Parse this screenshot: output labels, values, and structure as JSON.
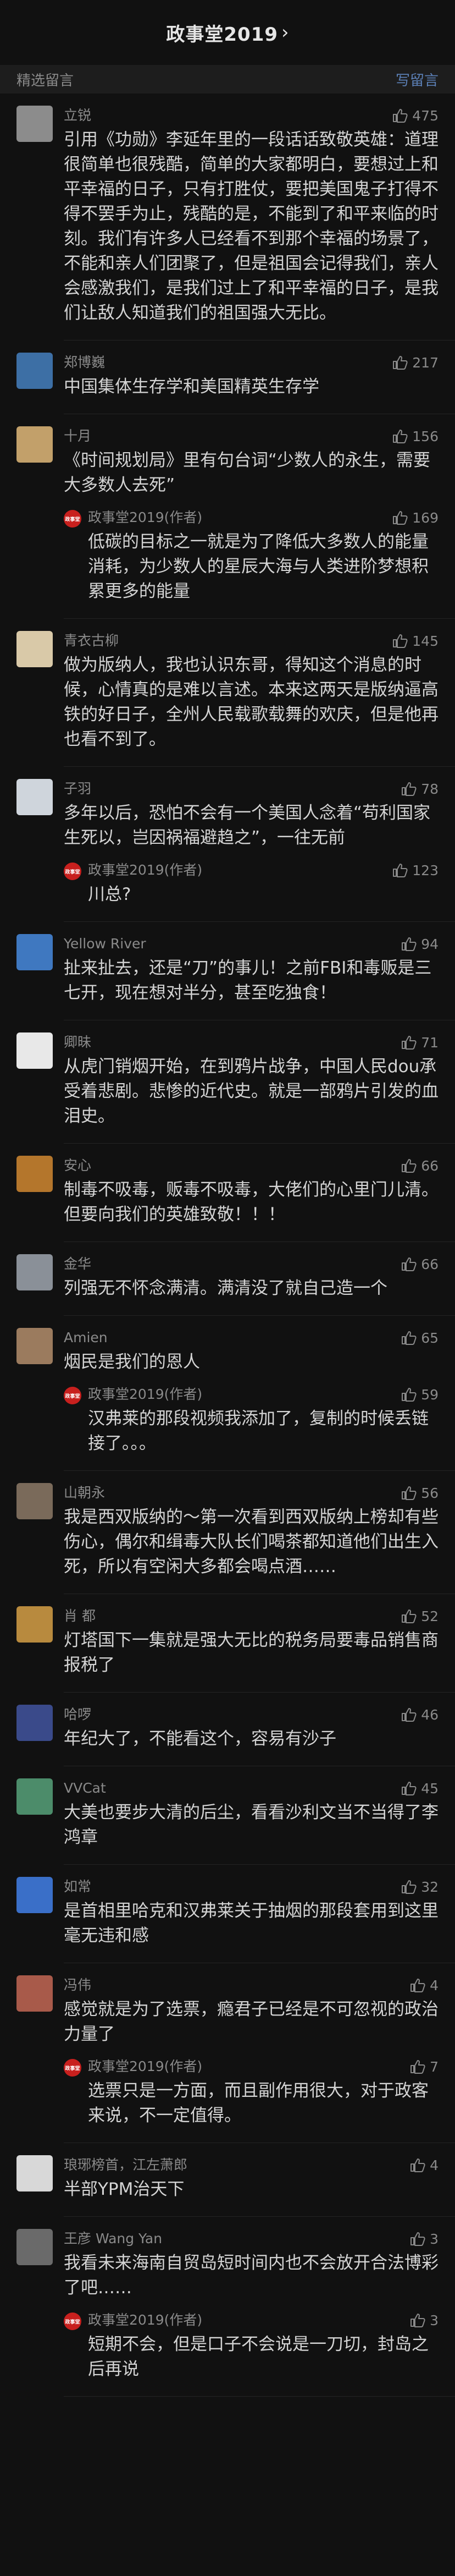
{
  "header": {
    "title": "政事堂2019",
    "chevron": "›"
  },
  "section": {
    "label": "精选留言",
    "action": "写留言"
  },
  "comments": [
    {
      "name": "立锐",
      "likes": "475",
      "avatar_color": "#8c8c8c",
      "text": "引用《功勋》李延年里的一段话话致敬英雄：道理很简单也很残酷，简单的大家都明白，要想过上和平幸福的日子，只有打胜仗，要把美国鬼子打得不得不罢手为止，残酷的是，不能到了和平来临的时刻。我们有许多人已经看不到那个幸福的场景了，不能和亲人们团聚了，但是祖国会记得我们，亲人会感激我们，是我们过上了和平幸福的日子，是我们让敌人知道我们的祖国强大无比。"
    },
    {
      "name": "郑博巍",
      "likes": "217",
      "avatar_color": "#3d6fa5",
      "text": "中国集体生存学和美国精英生存学"
    },
    {
      "name": "十月",
      "likes": "156",
      "avatar_color": "#c2a06a",
      "text": "《时间规划局》里有句台词“少数人的永生，需要大多数人去死”",
      "reply": {
        "name": "政事堂2019(作者)",
        "likes": "169",
        "text": "低碳的目标之一就是为了降低大多数人的能量消耗，为少数人的星辰大海与人类进阶梦想积累更多的能量"
      }
    },
    {
      "name": "青衣古柳",
      "likes": "145",
      "avatar_color": "#d9c9a8",
      "text": "做为版纳人，我也认识东哥，得知这个消息的时候，心情真的是难以言述。本来这两天是版纳逼高铁的好日子，全州人民载歌载舞的欢庆，但是他再也看不到了。"
    },
    {
      "name": "子羽",
      "likes": "78",
      "avatar_color": "#cfd5dc",
      "text": "多年以后，恐怕不会有一个美国人念着“苟利国家生死以，岂因祸福避趋之”，一往无前",
      "reply": {
        "name": "政事堂2019(作者)",
        "likes": "123",
        "text": "川总?"
      }
    },
    {
      "name": "Yellow River",
      "likes": "94",
      "avatar_color": "#3f78c0",
      "text": "扯来扯去，还是“刀”的事儿！之前FBI和毒贩是三七开，现在想对半分，甚至吃独食！"
    },
    {
      "name": "卿昧",
      "likes": "71",
      "avatar_color": "#e8e8e8",
      "text": "从虎门销烟开始，在到鸦片战争，中国人民dou承受着悲剧。悲惨的近代史。就是一部鸦片引发的血泪史。"
    },
    {
      "name": "安心",
      "likes": "66",
      "avatar_color": "#b4762c",
      "text": "制毒不吸毒，贩毒不吸毒，大佬们的心里门儿清。\n但要向我们的英雄致敬！！！"
    },
    {
      "name": "金华",
      "likes": "66",
      "avatar_color": "#8a9098",
      "text": "列强无不怀念满清。满清没了就自己造一个"
    },
    {
      "name": "Amien",
      "likes": "65",
      "avatar_color": "#9b7b5e",
      "text": "烟民是我们的恩人",
      "reply": {
        "name": "政事堂2019(作者)",
        "likes": "59",
        "text": "汉弗莱的那段视频我添加了，复制的时候丢链接了。。。"
      }
    },
    {
      "name": "山朝永",
      "likes": "56",
      "avatar_color": "#7a6a5a",
      "text": "我是西双版纳的～第一次看到西双版纳上榜却有些伤心，偶尔和缉毒大队长们喝茶都知道他们出生入死，所以有空闲大多都会喝点酒……"
    },
    {
      "name": "肖 都",
      "likes": "52",
      "avatar_color": "#b88a3e",
      "text": "灯塔国下一集就是强大无比的税务局要毒品销售商报税了"
    },
    {
      "name": "哈啰",
      "likes": "46",
      "avatar_color": "#3a4a8a",
      "text": "年纪大了，不能看这个，容易有沙子"
    },
    {
      "name": "VVCat",
      "likes": "45",
      "avatar_color": "#4c8c6a",
      "text": "大美也要步大清的后尘，看看沙利文当不当得了李鸿章"
    },
    {
      "name": "如常",
      "likes": "32",
      "avatar_color": "#3a6fc8",
      "text": "是首相里哈克和汉弗莱关于抽烟的那段套用到这里毫无违和感"
    },
    {
      "name": "冯伟",
      "likes": "4",
      "avatar_color": "#a85a4a",
      "text": "感觉就是为了选票，瘾君子已经是不可忽视的政治力量了",
      "reply": {
        "name": "政事堂2019(作者)",
        "likes": "7",
        "text": "选票只是一方面，而且副作用很大，对于政客来说，不一定值得。"
      }
    },
    {
      "name": "琅琊榜首，江左萧郎",
      "likes": "4",
      "avatar_color": "#d8d8d8",
      "text": "半部YPM治天下"
    },
    {
      "name": "王彦 Wang Yan",
      "likes": "3",
      "avatar_color": "#6a6a6a",
      "text": "我看未来海南自贸岛短时间内也不会放开合法博彩了吧……",
      "reply": {
        "name": "政事堂2019(作者)",
        "likes": "3",
        "text": "短期不会，但是口子不会说是一刀切，封岛之后再说"
      }
    }
  ]
}
